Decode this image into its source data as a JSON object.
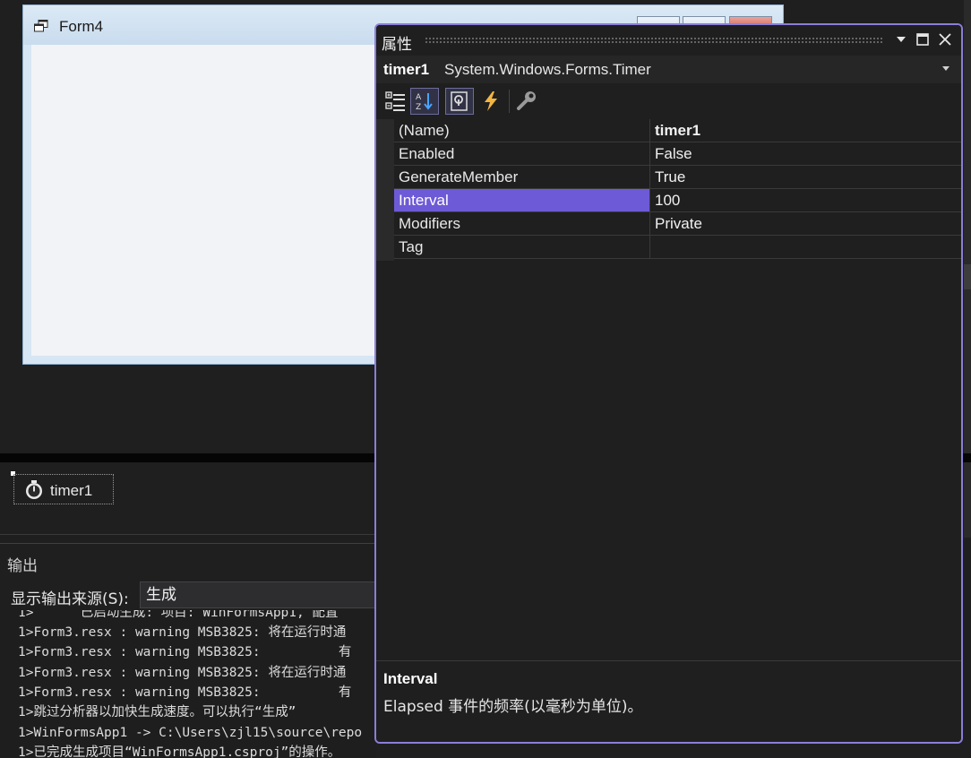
{
  "form": {
    "title": "Form4"
  },
  "tray": {
    "component_label": "timer1"
  },
  "output": {
    "title": "输出",
    "source_label": "显示输出来源(S):",
    "source_value": "生成",
    "lines": [
      "1>      已启动生成: 项目: WinFormsApp1, 配置",
      "1>Form3.resx : warning MSB3825: 将在运行时通",
      "1>Form3.resx : warning MSB3825:          有",
      "1>Form3.resx : warning MSB3825: 将在运行时通",
      "1>Form3.resx : warning MSB3825:          有",
      "1>跳过分析器以加快生成速度。可以执行“生成”",
      "1>WinFormsApp1 -> C:\\Users\\zjl15\\source\\repo",
      "1>已完成生成项目“WinFormsApp1.csproj”的操作。"
    ]
  },
  "properties": {
    "title": "属性",
    "object_name": "timer1",
    "object_type": "System.Windows.Forms.Timer",
    "rows": [
      {
        "name": "(Name)",
        "value": "timer1"
      },
      {
        "name": "Enabled",
        "value": "False"
      },
      {
        "name": "GenerateMember",
        "value": "True"
      },
      {
        "name": "Interval",
        "value": "100"
      },
      {
        "name": "Modifiers",
        "value": "Private"
      },
      {
        "name": "Tag",
        "value": ""
      }
    ],
    "selected_row": "Interval",
    "description": {
      "title": "Interval",
      "text": "Elapsed 事件的频率(以毫秒为单位)。"
    }
  },
  "colors": {
    "accent": "#6d5ad6",
    "window_border": "#8a7ed8",
    "background": "#1f1f1f"
  }
}
